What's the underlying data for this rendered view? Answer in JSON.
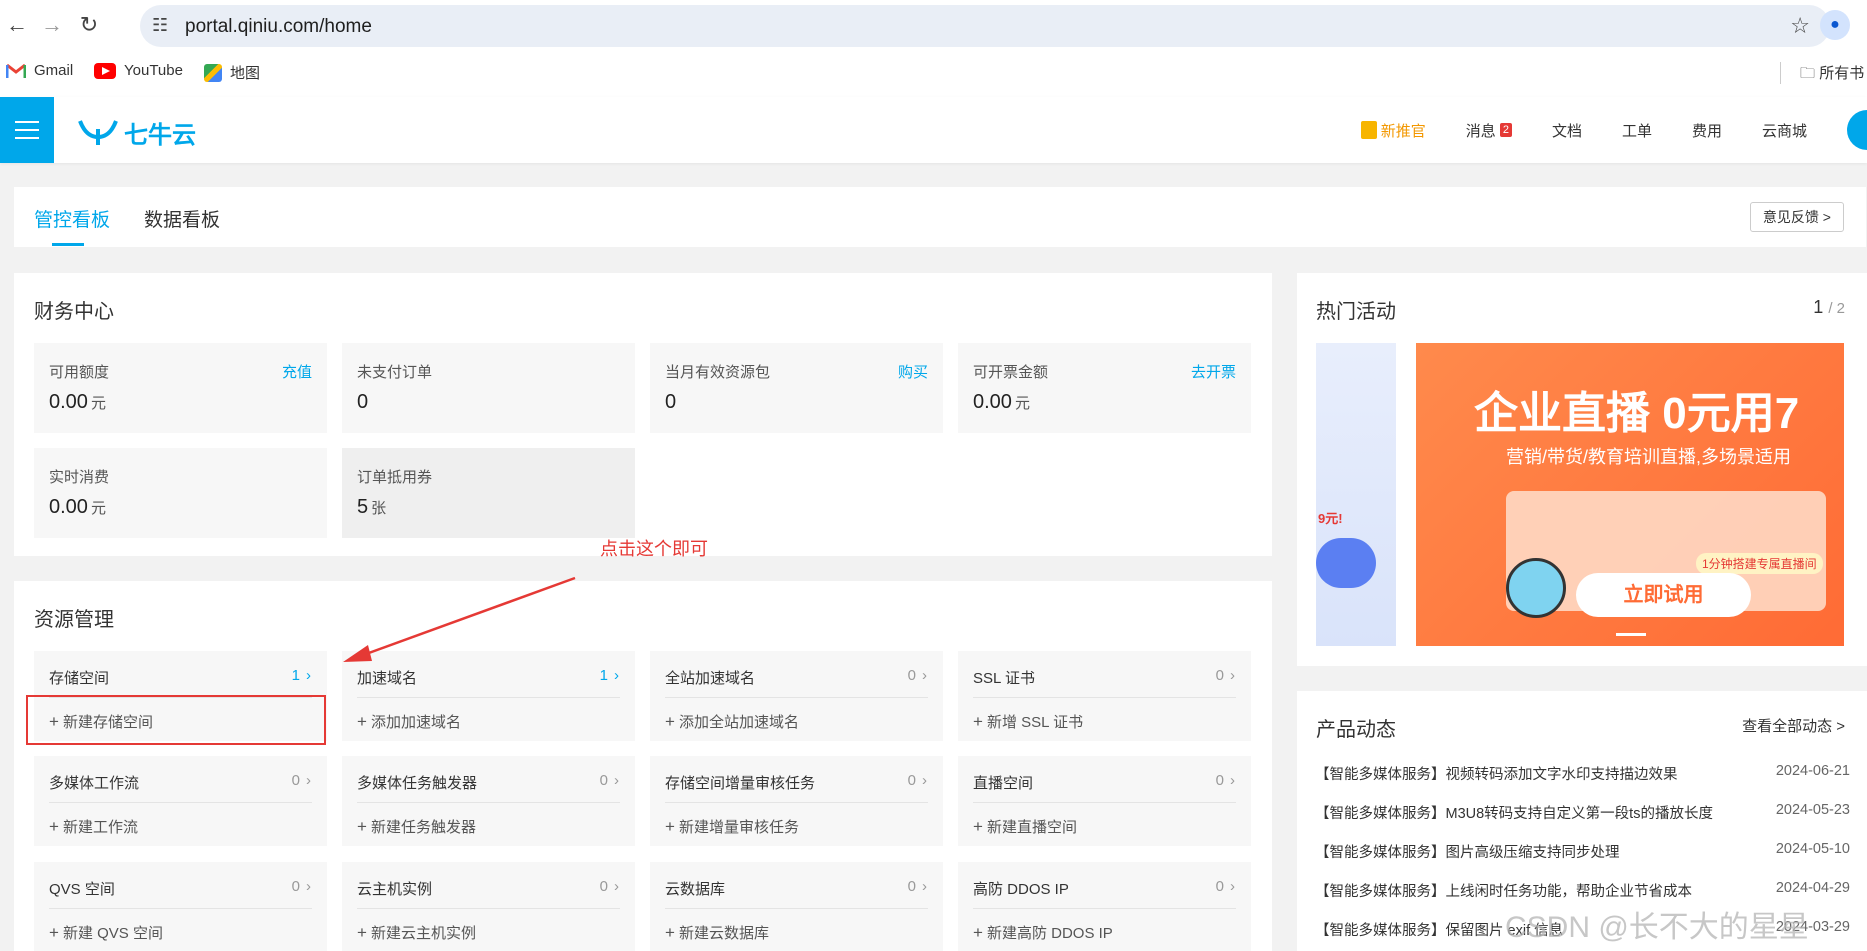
{
  "browser": {
    "url": "portal.qiniu.com/home",
    "bookmarks": [
      "Gmail",
      "YouTube",
      "地图"
    ],
    "folder_label": "所有书"
  },
  "header": {
    "logo_text": "七牛云",
    "nav": {
      "promo": "新推官",
      "messages": "消息",
      "messages_badge": "2",
      "docs": "文档",
      "tickets": "工单",
      "billing": "费用",
      "mall": "云商城"
    }
  },
  "tabs": {
    "active": "管控看板",
    "other": "数据看板",
    "feedback": "意见反馈 >"
  },
  "finance": {
    "title": "财务中心",
    "cells": [
      {
        "label": "可用额度",
        "action": "充值",
        "value": "0.00",
        "unit": "元"
      },
      {
        "label": "未支付订单",
        "action": "",
        "value": "0",
        "unit": ""
      },
      {
        "label": "当月有效资源包",
        "action": "购买",
        "value": "0",
        "unit": ""
      },
      {
        "label": "可开票金额",
        "action": "去开票",
        "value": "0.00",
        "unit": "元"
      },
      {
        "label": "实时消费",
        "action": "",
        "value": "0.00",
        "unit": "元"
      },
      {
        "label": "订单抵用券",
        "action": "",
        "value": "5",
        "unit": "张"
      }
    ]
  },
  "resources": {
    "title": "资源管理",
    "cells": [
      {
        "name": "存储空间",
        "count": "1",
        "add": "新建存储空间"
      },
      {
        "name": "加速域名",
        "count": "1",
        "add": "添加加速域名"
      },
      {
        "name": "全站加速域名",
        "count": "0",
        "add": "添加全站加速域名"
      },
      {
        "name": "SSL 证书",
        "count": "0",
        "add": "新增 SSL 证书"
      },
      {
        "name": "多媒体工作流",
        "count": "0",
        "add": "新建工作流"
      },
      {
        "name": "多媒体任务触发器",
        "count": "0",
        "add": "新建任务触发器"
      },
      {
        "name": "存储空间增量审核任务",
        "count": "0",
        "add": "新建增量审核任务"
      },
      {
        "name": "直播空间",
        "count": "0",
        "add": "新建直播空间"
      },
      {
        "name": "QVS 空间",
        "count": "0",
        "add": "新建 QVS 空间"
      },
      {
        "name": "云主机实例",
        "count": "0",
        "add": "新建云主机实例"
      },
      {
        "name": "云数据库",
        "count": "0",
        "add": "新建云数据库"
      },
      {
        "name": "高防 DDOS IP",
        "count": "0",
        "add": "新建高防 DDOS IP"
      }
    ]
  },
  "annotation": {
    "text": "点击这个即可"
  },
  "hot": {
    "title": "热门活动",
    "page": "1",
    "total": "/ 2",
    "side_text": "9元!",
    "banner_title": "企业直播 0元用7",
    "banner_sub": "营销/带货/教育培训直播,多场景适用",
    "banner_tag": "1分钟搭建专属直播间",
    "banner_cta": "立即试用"
  },
  "news": {
    "title": "产品动态",
    "more": "查看全部动态 >",
    "items": [
      {
        "text": "【智能多媒体服务】视频转码添加文字水印支持描边效果",
        "date": "2024-06-21"
      },
      {
        "text": "【智能多媒体服务】M3U8转码支持自定义第一段ts的播放长度",
        "date": "2024-05-23"
      },
      {
        "text": "【智能多媒体服务】图片高级压缩支持同步处理",
        "date": "2024-05-10"
      },
      {
        "text": "【智能多媒体服务】上线闲时任务功能，帮助企业节省成本",
        "date": "2024-04-29"
      },
      {
        "text": "【智能多媒体服务】保留图片 exif 信息",
        "date": "2024-03-29"
      }
    ]
  },
  "watermark": "CSDN @长不大的星星"
}
